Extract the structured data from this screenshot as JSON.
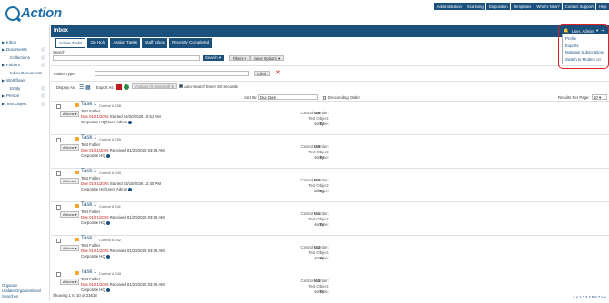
{
  "logo_text": "Action",
  "top_nav": [
    "Administration",
    "Scanning",
    "Disposition",
    "Templates",
    "What's New?",
    "Contact Support",
    "Help"
  ],
  "sidebar": [
    {
      "label": "Inbox",
      "arrow": "▶",
      "plus": false,
      "sub": false
    },
    {
      "label": "Documents",
      "arrow": "▶",
      "plus": true,
      "sub": false
    },
    {
      "label": "Collections",
      "arrow": "",
      "plus": true,
      "sub": true
    },
    {
      "label": "Folders",
      "arrow": "▶",
      "plus": true,
      "sub": false
    },
    {
      "label": "Inbox Documents",
      "arrow": "",
      "plus": false,
      "sub": true
    },
    {
      "label": "Workflows",
      "arrow": "▶",
      "plus": false,
      "sub": false
    },
    {
      "label": "Entity",
      "arrow": "",
      "plus": true,
      "sub": true
    },
    {
      "label": "Person",
      "arrow": "▶",
      "plus": true,
      "sub": false
    },
    {
      "label": "Text Object",
      "arrow": "▶",
      "plus": true,
      "sub": false
    }
  ],
  "sidebar_bottom": [
    "Organize",
    "Update Organizational",
    "Searches"
  ],
  "page_title": "Inbox",
  "user_label": "User, Admin",
  "user_menu": [
    "Profile",
    "Exports",
    "Maintain Subscriptions",
    "Switch to Modern UI"
  ],
  "tabs": [
    "Active Tasks",
    "On Hold",
    "Assign Tasks",
    "Staff Inbox",
    "Recently Completed"
  ],
  "search": {
    "label": "Search",
    "button": "Search",
    "filters": "Filters",
    "save_options": "Save Options"
  },
  "folder_type": {
    "label": "Folder Type:",
    "clear": "Clear"
  },
  "display": {
    "display_as": "Display As:",
    "export_as": "Export As:",
    "actions_selected": "Actions (0 Selected)",
    "auto_search": "Auto-Search Every 60 Seconds",
    "sort_by_label": "Sort By:",
    "sort_by_value": "Due Date",
    "descending": "Descending Order",
    "results_label": "Results Per Page:",
    "results_value": "10"
  },
  "actions_label": "Actions",
  "field_labels": {
    "control_number": "Control Number:",
    "text_object": "Text Object:",
    "type": "Type:"
  },
  "tasks": [
    {
      "name": "Task 1",
      "control": "Control # 238",
      "folder": "Test Folder",
      "due": "Due 01/21/2026",
      "event": "Started 04/20/2026 10:51 AM",
      "location": "Corporate HQ/User, Admin",
      "control_number": "238",
      "text_object": "",
      "type": "Home"
    },
    {
      "name": "Task 1",
      "control": "Control # 239",
      "folder": "Test Folder",
      "due": "Due 01/21/2026",
      "event": "Received 01/20/2026 03:08 AM",
      "location": "Corporate HQ",
      "control_number": "239",
      "text_object": "",
      "type": "Home"
    },
    {
      "name": "Task 1",
      "control": "Control # 240",
      "folder": "Test Folder",
      "due": "Due 01/21/2026",
      "event": "Started 03/18/2026 12:40 PM",
      "location": "Corporate HQ/User, Admin",
      "control_number": "260",
      "text_object": "",
      "type": "Billing"
    },
    {
      "name": "Task 1",
      "control": "Control # 241",
      "folder": "Test Folder",
      "due": "Due 01/21/2026",
      "event": "Received 01/20/2026 03:08 AM",
      "location": "Corporate HQ",
      "control_number": "241",
      "text_object": "",
      "type": "Home"
    },
    {
      "name": "Task 1",
      "control": "Control # 242",
      "folder": "Test Folder",
      "due": "Due 01/21/2026",
      "event": "Received 01/20/2026 03:08 AM",
      "location": "Corporate HQ",
      "control_number": "242",
      "text_object": "",
      "type": "Home"
    },
    {
      "name": "Task 1",
      "control": "Control # 243",
      "folder": "Test Folder",
      "due": "Due 01/21/2026",
      "event": "Received 01/20/2026 03:08 AM",
      "location": "Corporate HQ",
      "control_number": "263",
      "text_object": "",
      "type": "Home"
    }
  ],
  "footer_status": "Showing 1 to 10 of 23618",
  "pager": [
    "<",
    "<",
    "1",
    "2",
    "3",
    "4",
    "5",
    "6",
    "7",
    ">",
    ">"
  ],
  "colors": {
    "brand": "#1b4f7c",
    "logo": "#1d6fa8",
    "due": "#c21b1b",
    "highlight": "#e02020"
  }
}
